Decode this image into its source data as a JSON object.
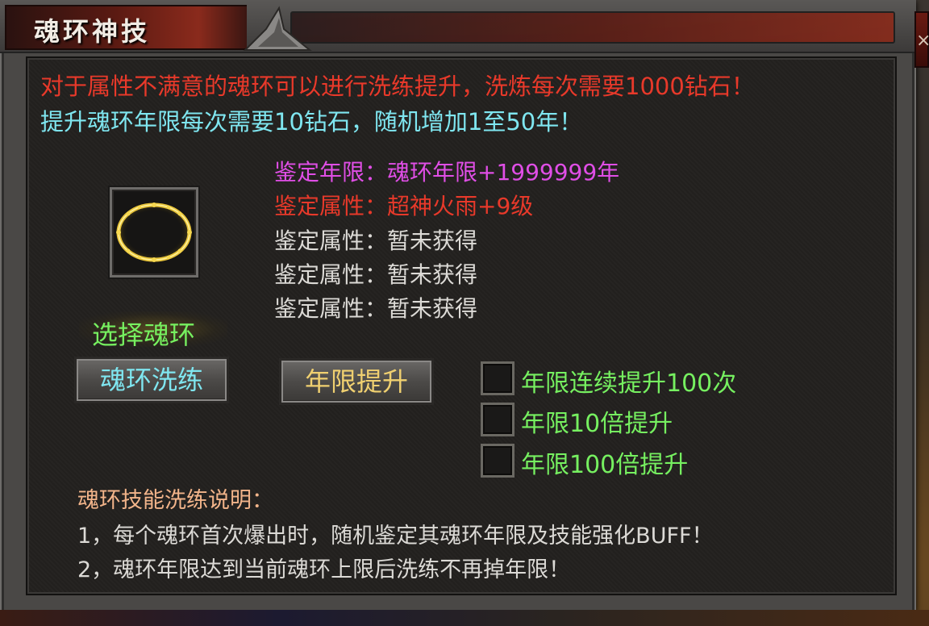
{
  "window": {
    "title": "魂环神技",
    "close_label": "×"
  },
  "intro": {
    "line1": "对于属性不满意的魂环可以进行洗练提升，洗炼每次需要1000钻石！",
    "line2": "提升魂环年限每次需要10钻石，随机增加1至50年！"
  },
  "attributes": [
    {
      "label": "鉴定年限：",
      "value": "魂环年限+1999999年",
      "color": "#e04ee6"
    },
    {
      "label": "鉴定属性：",
      "value": "超神火雨+9级",
      "color": "#e8392a"
    },
    {
      "label": "鉴定属性：",
      "value": "暂未获得",
      "color": "#dcdad6"
    },
    {
      "label": "鉴定属性：",
      "value": "暂未获得",
      "color": "#dcdad6"
    },
    {
      "label": "鉴定属性：",
      "value": "暂未获得",
      "color": "#dcdad6"
    }
  ],
  "slot": {
    "icon": "soul-ring-icon",
    "select_label": "选择魂环"
  },
  "buttons": {
    "refine_label": "魂环洗练",
    "upgrade_label": "年限提升"
  },
  "options": [
    {
      "label": "年限连续提升100次",
      "checked": false
    },
    {
      "label": "年限10倍提升",
      "checked": false
    },
    {
      "label": "年限100倍提升",
      "checked": false
    }
  ],
  "notes": {
    "heading": "魂环技能洗练说明：",
    "item1": "1，每个魂环首次爆出时，随机鉴定其魂环年限及技能强化BUFF！",
    "item2": "2，魂环年限达到当前魂环上限后洗练不再掉年限！"
  },
  "colors": {
    "warning": "#e8392a",
    "info": "#7fe6f0",
    "highlight": "#e04ee6",
    "option": "#76f060",
    "select": "#76f060",
    "refine_button_text": "#7fe6f0",
    "upgrade_button_text": "#f0d070",
    "notes_heading": "#f2b48a"
  }
}
